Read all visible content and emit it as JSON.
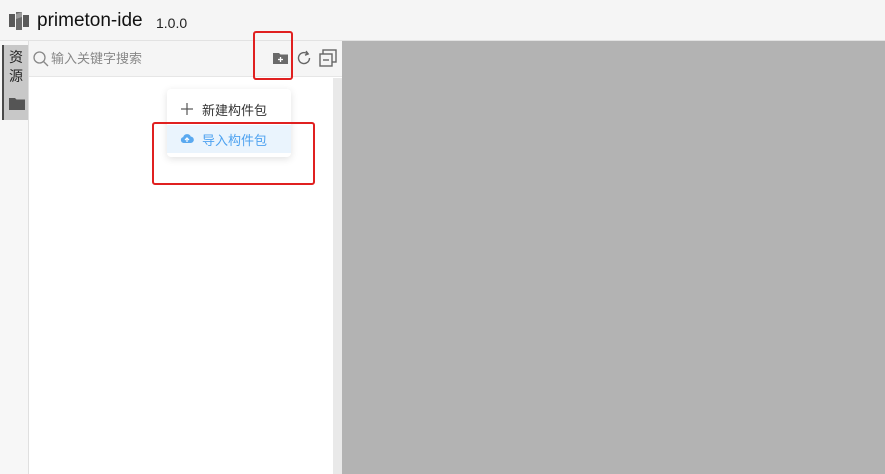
{
  "header": {
    "logo_icon": "primeton-logo-icon",
    "title": "primeton-ide",
    "version": "1.0.0"
  },
  "activity_bar": {
    "tab_label": "资源",
    "tab_icon": "folder-icon"
  },
  "explorer": {
    "search_placeholder": "输入关键字搜索",
    "tools": [
      {
        "name": "new-folder-button",
        "icon": "folder-plus-icon"
      },
      {
        "name": "refresh-button",
        "icon": "refresh-icon"
      },
      {
        "name": "collapse-all-button",
        "icon": "collapse-all-icon"
      }
    ]
  },
  "dropdown": {
    "items": [
      {
        "label": "新建构件包",
        "icon": "plus-icon"
      },
      {
        "label": "导入构件包",
        "icon": "cloud-upload-icon",
        "highlighted": true
      }
    ]
  },
  "colors": {
    "accent": "#4ea2f0",
    "annotation": "#e02020",
    "editor_background": "#b3b3b3"
  }
}
